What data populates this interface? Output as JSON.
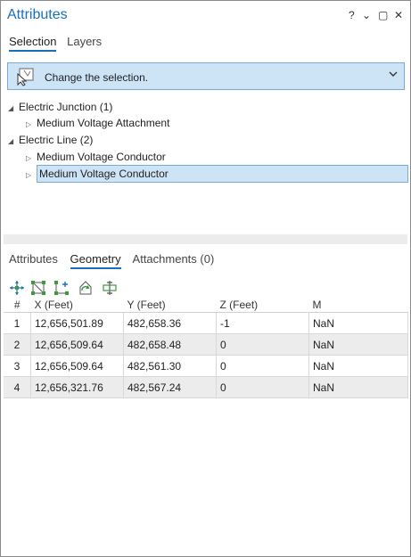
{
  "window": {
    "title": "Attributes",
    "controls": {
      "help": "?",
      "menu": "⌄",
      "restore": "▢",
      "close": "✕"
    }
  },
  "top_tabs": [
    {
      "label": "Selection",
      "active": true
    },
    {
      "label": "Layers",
      "active": false
    }
  ],
  "selection_bar": {
    "label": "Change the selection.",
    "icon": "change-selection-icon"
  },
  "tree": {
    "groups": [
      {
        "label": "Electric Junction (1)",
        "children": [
          "Medium Voltage Attachment"
        ]
      },
      {
        "label": "Electric Line (2)",
        "children": [
          "Medium Voltage Conductor",
          "Medium Voltage Conductor"
        ]
      }
    ],
    "selected_index": 2
  },
  "detail_tabs": [
    {
      "label": "Attributes",
      "active": false
    },
    {
      "label": "Geometry",
      "active": true
    },
    {
      "label": "Attachments (0)",
      "active": false
    }
  ],
  "geometry_tools": [
    "move-vertex-icon",
    "edit-vertices-icon",
    "add-vertex-icon",
    "flip-icon",
    "split-icon"
  ],
  "table": {
    "headers": [
      "#",
      "X (Feet)",
      "Y (Feet)",
      "Z (Feet)",
      "M"
    ],
    "rows": [
      [
        "1",
        "12,656,501.89",
        "482,658.36",
        "-1",
        "NaN"
      ],
      [
        "2",
        "12,656,509.64",
        "482,658.48",
        "0",
        "NaN"
      ],
      [
        "3",
        "12,656,509.64",
        "482,561.30",
        "0",
        "NaN"
      ],
      [
        "4",
        "12,656,321.76",
        "482,567.24",
        "0",
        "NaN"
      ]
    ]
  },
  "colors": {
    "accent": "#1a6fb8",
    "selection": "#cde3f6",
    "selection_border": "#7aaad6"
  }
}
